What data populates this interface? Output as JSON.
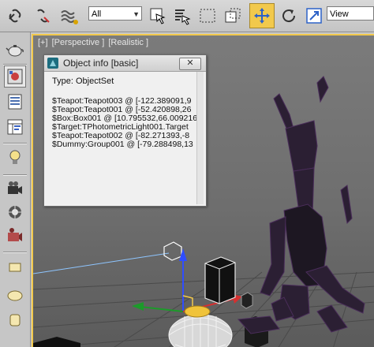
{
  "toolbar": {
    "selection_filter": "All",
    "reference_coord": "View"
  },
  "viewport": {
    "label_plus": "[+]",
    "label_view": "[Perspective ]",
    "label_shading": "[Realistic ]"
  },
  "dialog": {
    "title": "Object info [basic]",
    "close_label": "✕",
    "type_line": "Type: ObjectSet",
    "lines": [
      "$Teapot:Teapot003 @ [-122.389091,9",
      "$Teapot:Teapot001 @ [-52.420898,26",
      "$Box:Box001 @ [10.795532,66.009216",
      "$Target:TPhotometricLight001.Target",
      "$Teapot:Teapot002 @ [-82.271393,-8",
      "$Dummy:Group001 @ [-79.288498,13"
    ]
  }
}
